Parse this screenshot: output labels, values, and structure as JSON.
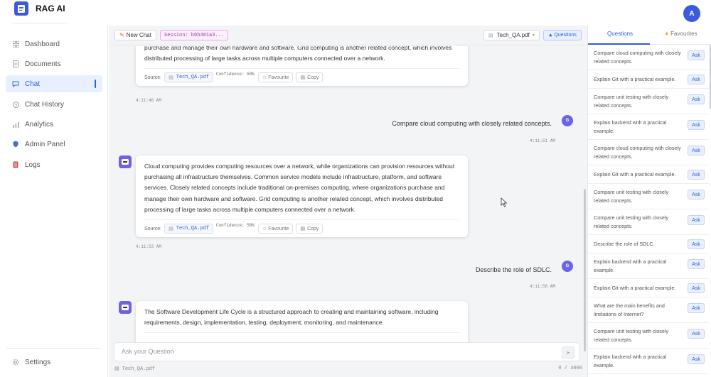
{
  "brand": {
    "name": "RAG AI"
  },
  "user": {
    "initial": "A"
  },
  "sidebar": {
    "items": [
      {
        "label": "Dashboard",
        "icon": "grid-icon"
      },
      {
        "label": "Documents",
        "icon": "document-icon"
      },
      {
        "label": "Chat",
        "icon": "chat-icon",
        "active": true
      },
      {
        "label": "Chat History",
        "icon": "clock-icon"
      },
      {
        "label": "Analytics",
        "icon": "bar-chart-icon"
      },
      {
        "label": "Admin Panel",
        "icon": "shield-icon"
      },
      {
        "label": "Logs",
        "icon": "log-icon"
      }
    ],
    "settings_label": "Settings"
  },
  "toolbar": {
    "new_chat_label": "New Chat",
    "session_label": "Session: b0b401a3...",
    "file_select_value": "Tech_QA.pdf",
    "questions_label": "Questions"
  },
  "messages": [
    {
      "type": "bot",
      "text": "purchase and manage their own hardware and software. Grid computing is another related concept, which involves distributed processing of large tasks across multiple computers connected over a network.",
      "source_label": "Source:",
      "source_file": "Tech_QA.pdf",
      "confidence": "Confidence: 50%",
      "favourite_label": "Favourite",
      "copy_label": "Copy",
      "time": "4:11:46 AM"
    },
    {
      "type": "user",
      "text": "Compare cloud computing with closely related concepts.",
      "avatar_initial": "G",
      "time": "4:11:51 AM"
    },
    {
      "type": "bot",
      "text": "Cloud computing provides computing resources over a network, while organizations can provision resources without purchasing all infrastructure themselves. Common service models include infrastructure, platform, and software services. Closely related concepts include traditional on-premises computing, where organizations purchase and manage their own hardware and software. Grid computing is another related concept, which involves distributed processing of large tasks across multiple computers connected over a network.",
      "source_label": "Source:",
      "source_file": "Tech_QA.pdf",
      "confidence": "Confidence: 50%",
      "favourite_label": "Favourite",
      "copy_label": "Copy",
      "time": "4:11:53 AM"
    },
    {
      "type": "user",
      "text": "Describe the role of SDLC.",
      "avatar_initial": "G",
      "time": "4:11:56 AM"
    },
    {
      "type": "bot",
      "text": "The Software Development Life Cycle is a structured approach to creating and maintaining software, including requirements, design, implementation, testing, deployment, monitoring, and maintenance."
    }
  ],
  "input": {
    "placeholder": "Ask your Question",
    "value": "",
    "file": "Tech_QA.pdf",
    "char_count": "0 / 4000"
  },
  "right_panel": {
    "tab_questions": "Questions",
    "tab_favourites": "Favourites",
    "ask_label": "Ask",
    "questions": [
      "Compare cloud computing with closely related concepts.",
      "Explain Git with a practical example.",
      "Compare unit testing with closely related concepts.",
      "Explain backend with a practical example.",
      "Compare cloud computing with closely related concepts.",
      "Explain Git with a practical example.",
      "Compare unit testing with closely related concepts.",
      "Compare unit testing with closely related concepts.",
      "Describe the role of SDLC.",
      "Explain backend with a practical example.",
      "Explain Git with a practical example.",
      "What are the main benefits and limitations of Internet?",
      "Compare unit testing with closely related concepts.",
      "Explain backend with a practical example."
    ]
  },
  "colors": {
    "accent": "#2b5fd9",
    "bot_avatar": "#6c63e6",
    "session_badge": "#a23ba4"
  }
}
